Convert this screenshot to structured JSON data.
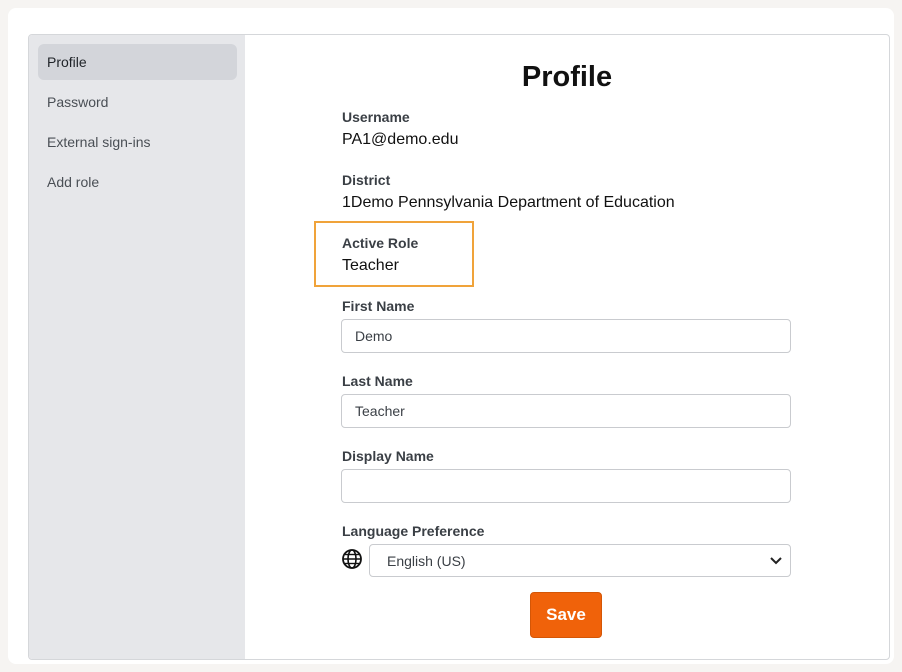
{
  "sidebar": {
    "items": [
      {
        "label": "Profile"
      },
      {
        "label": "Password"
      },
      {
        "label": "External sign-ins"
      },
      {
        "label": "Add role"
      }
    ]
  },
  "main": {
    "title": "Profile",
    "username": {
      "label": "Username",
      "value": "PA1@demo.edu"
    },
    "district": {
      "label": "District",
      "value": "1Demo Pennsylvania Department of Education"
    },
    "active_role": {
      "label": "Active Role",
      "value": "Teacher"
    },
    "first_name": {
      "label": "First Name",
      "value": "Demo"
    },
    "last_name": {
      "label": "Last Name",
      "value": "Teacher"
    },
    "display_name": {
      "label": "Display Name",
      "value": ""
    },
    "language": {
      "label": "Language Preference",
      "selected": "English (US)",
      "icon": "globe-icon"
    },
    "save_label": "Save"
  },
  "colors": {
    "accent": "#f0620a",
    "highlight_border": "#f0a33a",
    "sidebar_bg": "#e6e7ea",
    "sidebar_active": "#d3d5da"
  }
}
